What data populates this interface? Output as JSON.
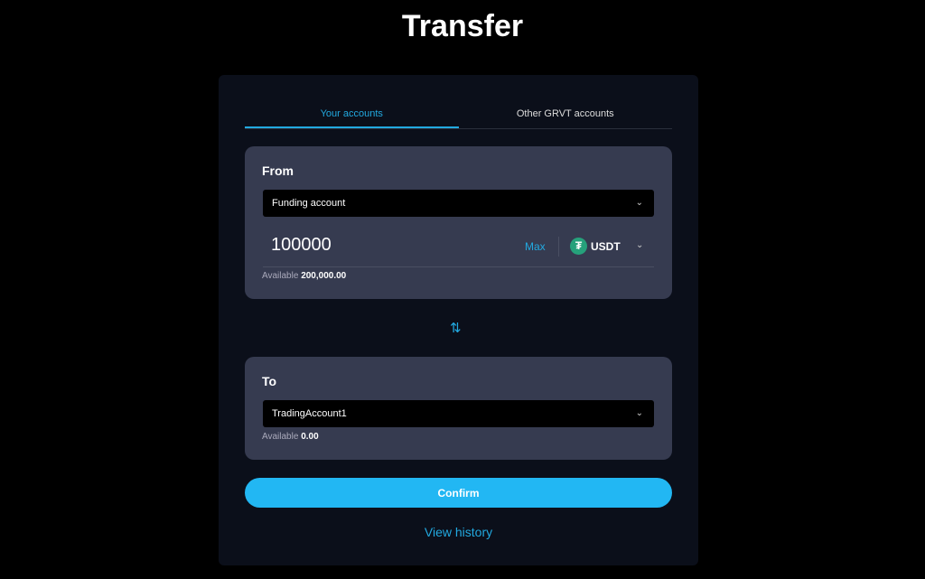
{
  "title": "Transfer",
  "tabs": [
    {
      "label": "Your accounts",
      "active": true
    },
    {
      "label": "Other GRVT accounts",
      "active": false
    }
  ],
  "from": {
    "label": "From",
    "account": "Funding account",
    "amount": "100000",
    "max_label": "Max",
    "currency": "USDT",
    "currency_icon": "tether-icon",
    "available_label": "Available",
    "available_value": "200,000.00"
  },
  "to": {
    "label": "To",
    "account": "TradingAccount1",
    "available_label": "Available",
    "available_value": "0.00"
  },
  "confirm_label": "Confirm",
  "history_label": "View history",
  "colors": {
    "accent": "#22a9e0",
    "button": "#22b7f3",
    "panel": "#363b50",
    "card": "#0b0f1a"
  }
}
